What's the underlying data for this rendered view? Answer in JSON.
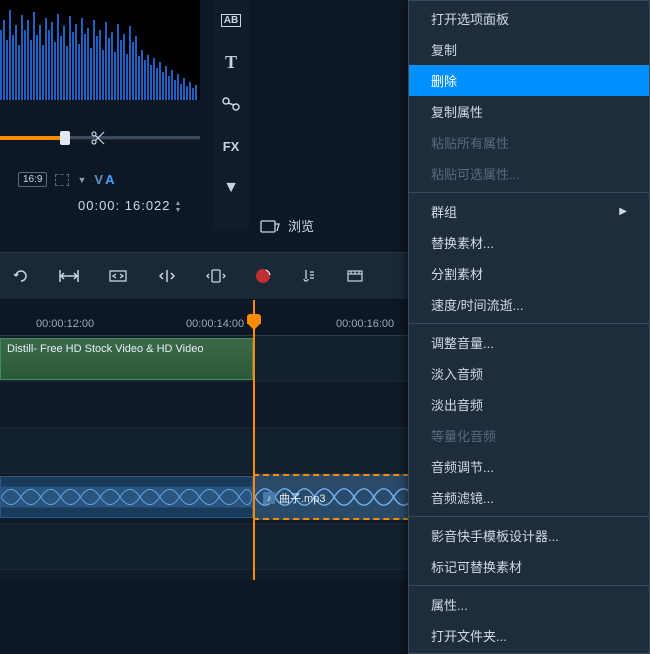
{
  "preview": {
    "aspect_ratio": "16:9",
    "va_v": "V",
    "va_a": "A",
    "timecode": "00:00: 16:022"
  },
  "side_toolbar": {
    "ab": "AB",
    "text": "T",
    "fx": "FX"
  },
  "browse_label": "浏览",
  "timeline": {
    "ticks": [
      "00:00:12:00",
      "00:00:14:00",
      "00:00:16:00"
    ],
    "video_clip_label": "Distill- Free HD Stock Video & HD Video",
    "audio_clip_label": "曲子.mp3"
  },
  "context_menu": {
    "items": [
      {
        "label": "打开选项面板",
        "state": "normal"
      },
      {
        "label": "复制",
        "state": "normal"
      },
      {
        "label": "删除",
        "state": "highlighted"
      },
      {
        "label": "复制属性",
        "state": "normal"
      },
      {
        "label": "粘贴所有属性",
        "state": "disabled"
      },
      {
        "label": "粘贴可选属性...",
        "state": "disabled"
      },
      {
        "sep": true
      },
      {
        "label": "群组",
        "state": "normal",
        "submenu": true
      },
      {
        "label": "替换素材...",
        "state": "normal"
      },
      {
        "label": "分割素材",
        "state": "normal"
      },
      {
        "label": "速度/时间流逝...",
        "state": "normal"
      },
      {
        "sep": true
      },
      {
        "label": "调整音量...",
        "state": "normal"
      },
      {
        "label": "淡入音频",
        "state": "normal"
      },
      {
        "label": "淡出音频",
        "state": "normal"
      },
      {
        "label": "等量化音频",
        "state": "disabled"
      },
      {
        "label": "音频调节...",
        "state": "normal"
      },
      {
        "label": "音频滤镜...",
        "state": "normal"
      },
      {
        "sep": true
      },
      {
        "label": "影音快手模板设计器...",
        "state": "normal"
      },
      {
        "label": "标记可替换素材",
        "state": "normal"
      },
      {
        "sep": true
      },
      {
        "label": "属性...",
        "state": "normal"
      },
      {
        "label": "打开文件夹...",
        "state": "normal"
      }
    ]
  }
}
